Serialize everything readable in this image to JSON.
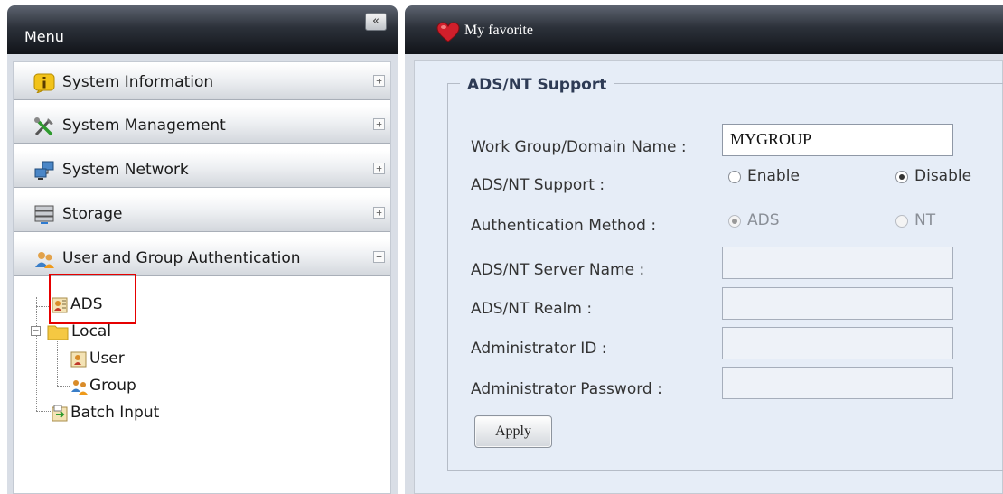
{
  "menu": {
    "title": "Menu",
    "collapse_glyph": "«",
    "categories": [
      {
        "label": "System Information",
        "icon": "info-icon",
        "toggle": "+"
      },
      {
        "label": "System Management",
        "icon": "tools-icon",
        "toggle": "+"
      },
      {
        "label": "System Network",
        "icon": "network-icon",
        "toggle": "+"
      },
      {
        "label": "Storage",
        "icon": "storage-icon",
        "toggle": "+"
      },
      {
        "label": "User and Group Authentication",
        "icon": "users-icon",
        "toggle": "−"
      }
    ],
    "tree": {
      "ads": "ADS",
      "local": "Local",
      "user": "User",
      "group": "Group",
      "batch_input": "Batch Input"
    }
  },
  "favorite": {
    "title": "My favorite",
    "icon": "heart-icon"
  },
  "ads_form": {
    "legend": "ADS/NT Support",
    "workgroup_label": "Work Group/Domain Name :",
    "workgroup_value": "MYGROUP",
    "support_label": "ADS/NT Support :",
    "support_options": {
      "enable": "Enable",
      "disable": "Disable",
      "selected": "Disable"
    },
    "auth_label": "Authentication Method :",
    "auth_options": {
      "ads": "ADS",
      "nt": "NT",
      "selected": "ADS"
    },
    "server_label": "ADS/NT Server Name :",
    "server_value": "",
    "realm_label": "ADS/NT Realm :",
    "realm_value": "",
    "admin_id_label": "Administrator ID :",
    "admin_id_value": "",
    "admin_pw_label": "Administrator Password :",
    "admin_pw_value": "",
    "apply_label": "Apply"
  },
  "colors": {
    "header_dark": "#1b1f26",
    "panel_bg": "#d9dee6",
    "form_bg": "#e6edf7",
    "highlight": "#e60000"
  }
}
